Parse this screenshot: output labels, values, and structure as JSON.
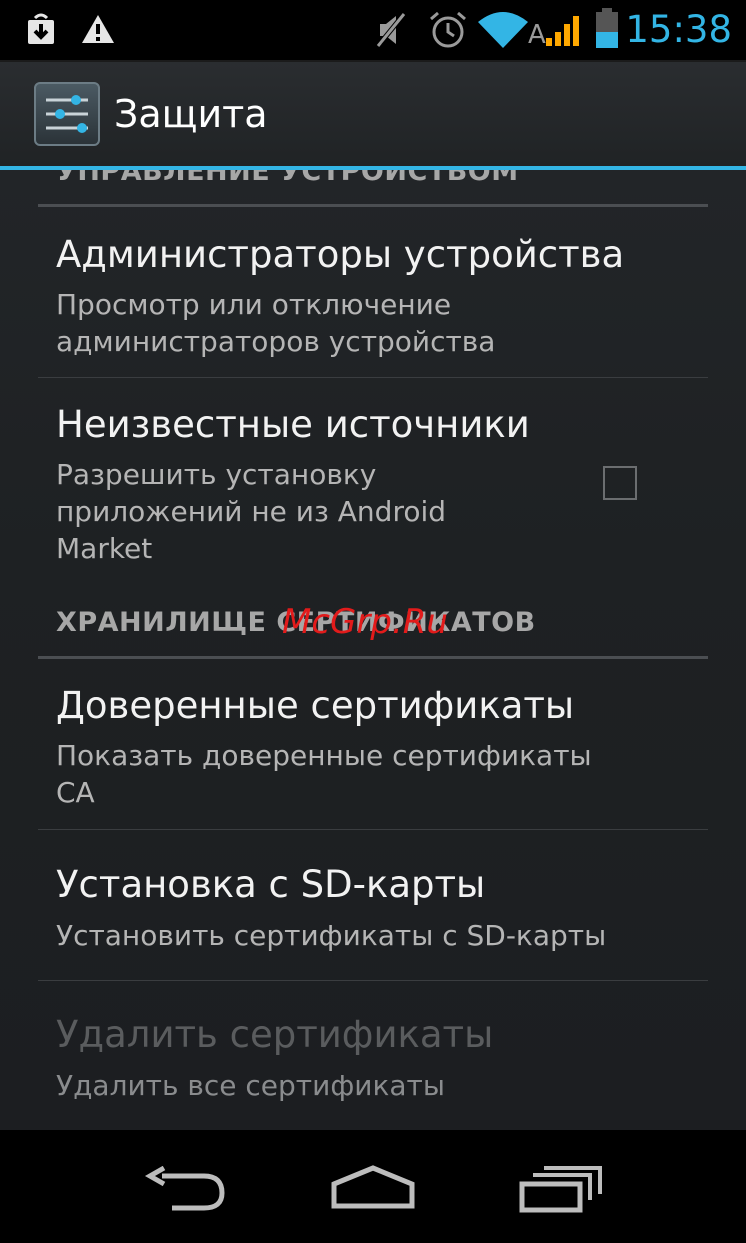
{
  "status_bar": {
    "time": "15:38",
    "network_label": "A",
    "icons": [
      "download-icon",
      "warning-icon",
      "mute-icon",
      "alarm-icon",
      "wifi-icon",
      "signal-icon",
      "battery-icon"
    ],
    "accent_color": "#33b5e5"
  },
  "action_bar": {
    "title": "Защита",
    "icon": "settings-sliders-icon"
  },
  "sections": {
    "device_admin_header": "УПРАВЛЕНИЕ УСТРОЙСТВОМ",
    "cert_storage_header": "ХРАНИЛИЩЕ СЕРТИФИКАТОВ"
  },
  "prefs": {
    "device_admins": {
      "title": "Администраторы устройства",
      "summary": "Просмотр или отключение\nадминистраторов устройства"
    },
    "unknown_sources": {
      "title": "Неизвестные источники",
      "summary": "Разрешить установку\nприложений не из Android\nMarket",
      "checked": false
    },
    "trusted_certs": {
      "title": "Доверенные сертификаты",
      "summary": "Показать доверенные сертификаты\nCA"
    },
    "install_sd": {
      "title": "Установка с SD-карты",
      "summary": "Установить сертификаты с SD-карты"
    },
    "clear_certs": {
      "title": "Удалить сертификаты",
      "summary": "Удалить все сертификаты",
      "enabled": false
    }
  },
  "watermark": "McGrp.Ru",
  "nav_bar": {
    "icons": [
      "back-icon",
      "home-icon",
      "recent-apps-icon"
    ]
  }
}
